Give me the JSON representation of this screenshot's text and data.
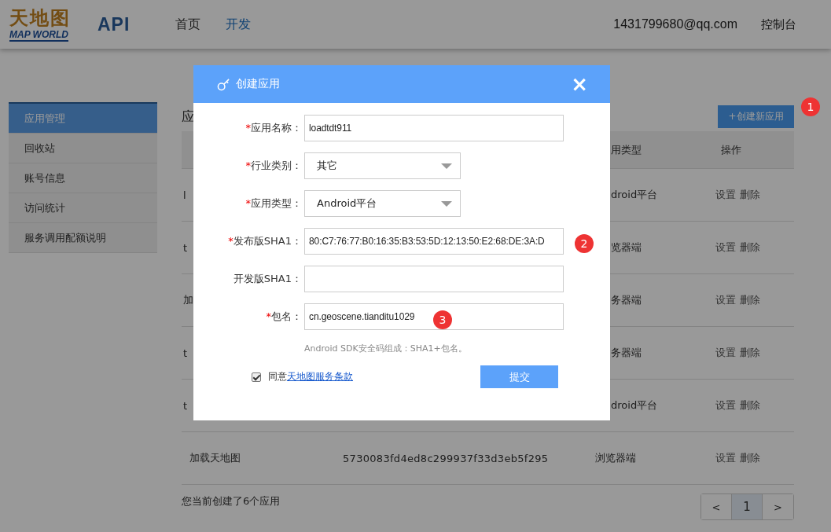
{
  "header": {
    "logo": {
      "title": "天地图",
      "subtitle": "MAP WORLD"
    },
    "product": "API",
    "nav": [
      {
        "label": "首页",
        "selected": false
      },
      {
        "label": "开发",
        "selected": true
      }
    ],
    "account": "1431799680@qq.com",
    "console": "控制台"
  },
  "sidebar": {
    "items": [
      {
        "label": "应用管理",
        "selected": true
      },
      {
        "label": "回收站",
        "selected": false
      },
      {
        "label": "账号信息",
        "selected": false
      },
      {
        "label": "访问统计",
        "selected": false
      },
      {
        "label": "服务调用配额说明",
        "selected": false
      }
    ]
  },
  "main": {
    "heading": "应",
    "create_button": "+创建新应用",
    "table": {
      "columns": [
        "用类型",
        "操作"
      ],
      "rows": [
        {
          "column_1": "l",
          "column_3": "droid平台",
          "actions": [
            "设置",
            "删除"
          ]
        },
        {
          "column_1": "t",
          "column_3": "览器端",
          "actions": [
            "设置",
            "删除"
          ]
        },
        {
          "column_1": "加",
          "column_3": "务器端",
          "actions": [
            "设置",
            "删除"
          ]
        },
        {
          "column_1": "t",
          "column_3": "务器端",
          "actions": [
            "设置",
            "删除"
          ]
        },
        {
          "column_1": "t",
          "column_3": "droid平台",
          "actions": [
            "设置",
            "删除"
          ]
        },
        {
          "column_1": "加载天地图",
          "column_2": "5730083fd4ed8c299937f33d3eb5f295",
          "column_3": "浏览器端",
          "actions": [
            "设置",
            "删除"
          ]
        }
      ]
    },
    "summary": "您当前创建了6个应用",
    "pagination": [
      {
        "label": "<",
        "selected": false
      },
      {
        "label": "1",
        "selected": true
      },
      {
        "label": ">",
        "selected": false
      }
    ]
  },
  "dialog": {
    "title": "创建应用",
    "close": "×",
    "fields": [
      {
        "required_mark": "*",
        "label": "应用名称：",
        "kind": "text",
        "value": "loadtdt911"
      },
      {
        "required_mark": "*",
        "label": "行业类别：",
        "kind": "select",
        "value": "其它"
      },
      {
        "required_mark": "*",
        "label": "应用类型：",
        "kind": "select",
        "value": "Android平台"
      },
      {
        "required_mark": "*",
        "label": "发布版SHA1：",
        "kind": "text",
        "value": "80:C7:76:77:B0:16:35:B3:53:5D:12:13:50:E2:68:DE:3A:D"
      },
      {
        "label": "开发版SHA1：",
        "kind": "text"
      },
      {
        "required_mark": "*",
        "label": "包名：",
        "kind": "text",
        "value": "cn.geoscene.tianditu1029"
      }
    ],
    "hint": "Android SDK安全码组成：SHA1+包名。",
    "agree": {
      "checked": true,
      "text": "同意",
      "link": "天地图服务条款"
    },
    "submit": "提交"
  },
  "annotations": [
    {
      "number": "1"
    },
    {
      "number": "2"
    },
    {
      "number": "3"
    }
  ]
}
